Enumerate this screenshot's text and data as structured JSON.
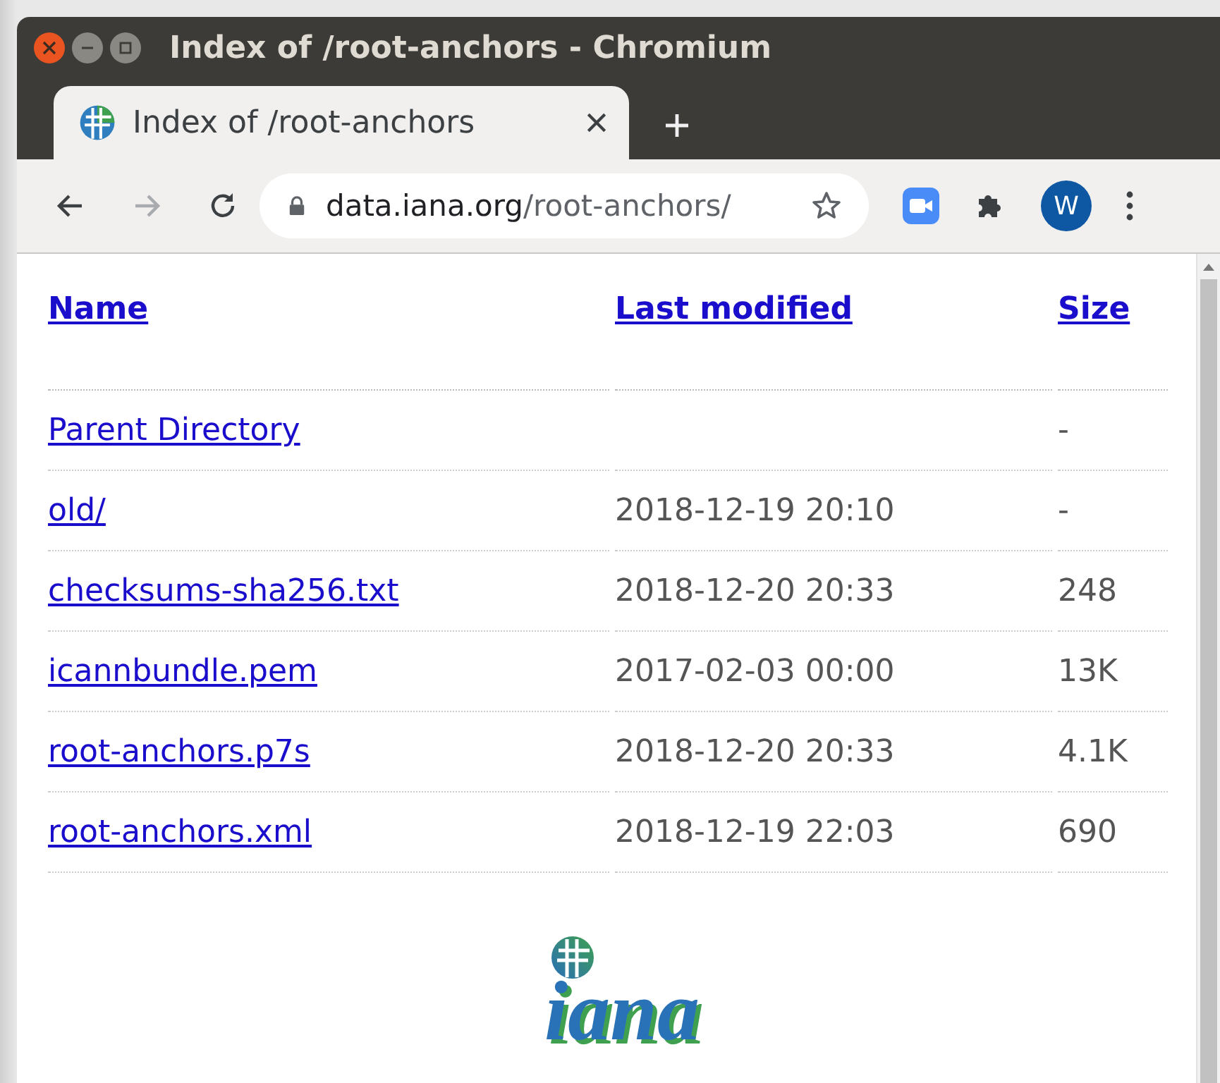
{
  "window": {
    "title": "Index of /root-anchors - Chromium"
  },
  "tabs": [
    {
      "label": "Index of /root-anchors",
      "selected": true
    }
  ],
  "address_bar": {
    "host": "data.iana.org",
    "path": "/root-anchors/"
  },
  "profile": {
    "initial": "W"
  },
  "table": {
    "columns": [
      "Name",
      "Last modified",
      "Size"
    ],
    "rows": [
      {
        "name": "Parent Directory",
        "modified": "",
        "size": "-"
      },
      {
        "name": "old/",
        "modified": "2018-12-19 20:10",
        "size": "-"
      },
      {
        "name": "checksums-sha256.txt",
        "modified": "2018-12-20 20:33",
        "size": "248"
      },
      {
        "name": "icannbundle.pem",
        "modified": "2017-02-03 00:00",
        "size": "13K"
      },
      {
        "name": "root-anchors.p7s",
        "modified": "2018-12-20 20:33",
        "size": "4.1K"
      },
      {
        "name": "root-anchors.xml",
        "modified": "2018-12-19 22:03",
        "size": "690"
      }
    ]
  },
  "logo": {
    "text": "iana"
  }
}
